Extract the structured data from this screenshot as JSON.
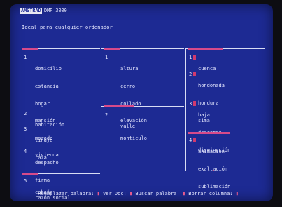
{
  "header": {
    "brand": "AMSTRAD",
    "model": "DMP 3000",
    "subtitle": "Ideal para cualquier ordenador"
  },
  "columns": {
    "col1": {
      "groups": [
        {
          "num": "1",
          "words": [
            "domicilio",
            "estancia",
            "hogar",
            "mansión",
            "morada",
            "vivienda"
          ]
        },
        {
          "num": "2",
          "words": [
            "habitación"
          ]
        },
        {
          "num": "3",
          "words": [
            "linaje",
            "raza"
          ]
        },
        {
          "num": "4",
          "words": [
            "despacho",
            "firma",
            "razón social"
          ]
        },
        {
          "num": "5",
          "words": [
            "cabaña"
          ]
        }
      ]
    },
    "col2": {
      "groups": [
        {
          "num": "1",
          "words": [
            "altura",
            "cerro",
            "collado",
            "elevación",
            "montículo"
          ]
        },
        {
          "num": "2",
          "words": [
            "valle"
          ]
        }
      ]
    },
    "col3": {
      "groups": [
        {
          "num": "1",
          "words": [
            "cuenca"
          ]
        },
        {
          "num": "2",
          "words": [
            "hondonada",
            "hondura",
            "sima"
          ]
        },
        {
          "num": "3",
          "words": [
            "baja",
            "descenso",
            "disminución"
          ]
        },
        {
          "num": "4",
          "words": [
            "animación",
            "exaltación",
            "sublimación"
          ]
        }
      ]
    }
  },
  "statusbar": {
    "replace_label": "Reemplazar palabra:",
    "view_label": "Ver Doc:",
    "search_label": "Buscar palabra:",
    "delete_label": "Borrar columna:",
    "accent": "#e85a8e"
  },
  "colors": {
    "screen_bg": "#1d2a93",
    "text": "#e6e8ff",
    "highlight": "#d64a8a"
  }
}
